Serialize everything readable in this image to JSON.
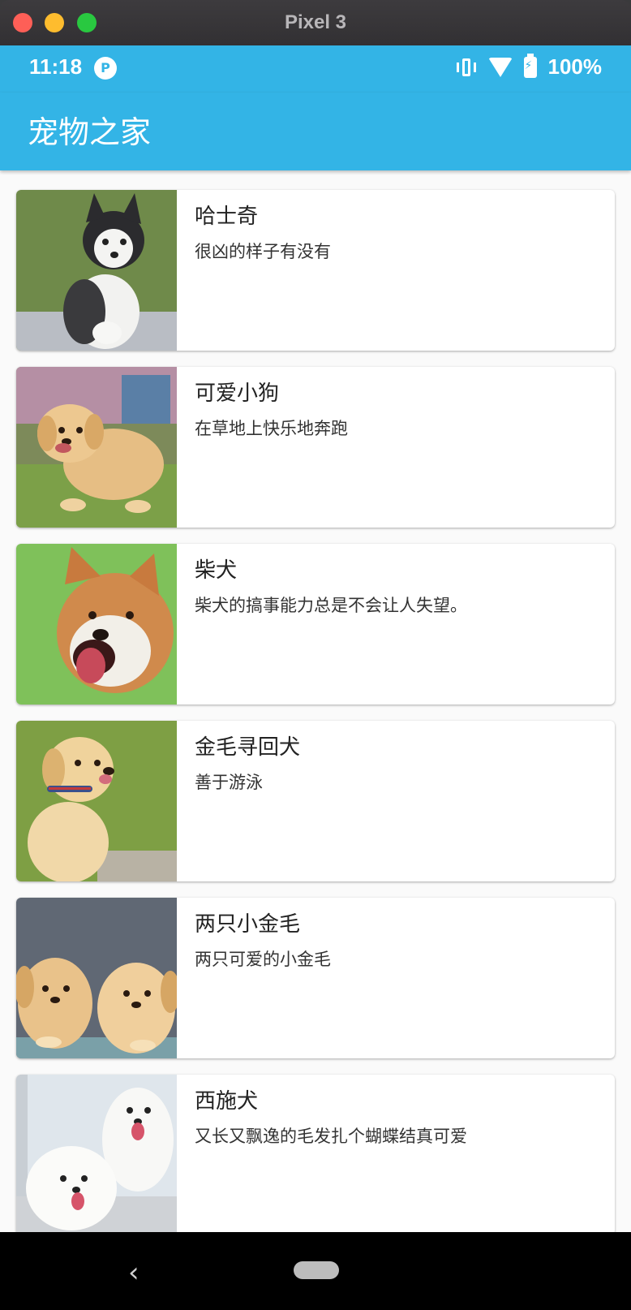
{
  "window": {
    "title": "Pixel 3"
  },
  "status_bar": {
    "time": "11:18",
    "app_icon_glyph": "P",
    "battery": "100%"
  },
  "app_bar": {
    "title": "宠物之家"
  },
  "pets": [
    {
      "title": "哈士奇",
      "subtitle": "很凶的样子有没有",
      "image": "husky-puppy"
    },
    {
      "title": "可爱小狗",
      "subtitle": "在草地上快乐地奔跑",
      "image": "golden-puppy-running"
    },
    {
      "title": "柴犬",
      "subtitle": "柴犬的搞事能力总是不会让人失望。",
      "image": "shiba-inu"
    },
    {
      "title": "金毛寻回犬",
      "subtitle": "善于游泳",
      "image": "golden-retriever-puppy"
    },
    {
      "title": "两只小金毛",
      "subtitle": "两只可爱的小金毛",
      "image": "two-golden-puppies"
    },
    {
      "title": "西施犬",
      "subtitle": "又长又飘逸的毛发扎个蝴蝶结真可爱",
      "image": "white-fluffy-puppies"
    }
  ],
  "colors": {
    "primary": "#33b4e6",
    "background": "#fafafa"
  }
}
